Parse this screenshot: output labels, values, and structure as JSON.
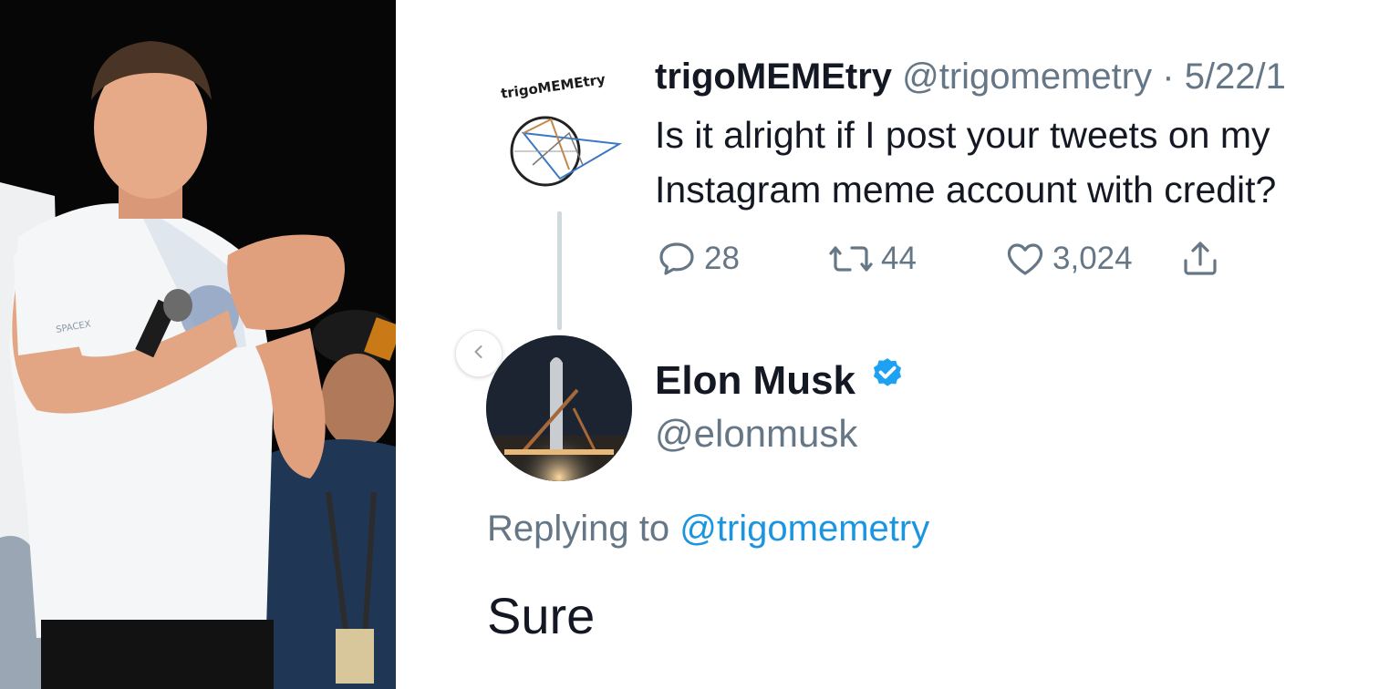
{
  "original_tweet": {
    "display_name": "trigoMEMEtry",
    "handle": "@trigomemetry",
    "separator": "·",
    "date": "5/22/1",
    "text": "Is it alright if I post your tweets on my Instagram meme account with credit?",
    "avatar_logo_text": "trigoMEMEtry",
    "actions": {
      "reply_count": "28",
      "retweet_count": "44",
      "like_count": "3,024"
    }
  },
  "reply_tweet": {
    "display_name": "Elon Musk",
    "handle": "@elonmusk",
    "verified": true,
    "replying_prefix": "Replying to",
    "replying_mention": "@trigomemetry",
    "text": "Sure"
  },
  "photo": {
    "shirt_text": "SPACEX"
  },
  "colors": {
    "link_blue": "#1b95e0",
    "verified_blue": "#1da1f2",
    "muted_gray": "#657786",
    "text_dark": "#141823"
  }
}
